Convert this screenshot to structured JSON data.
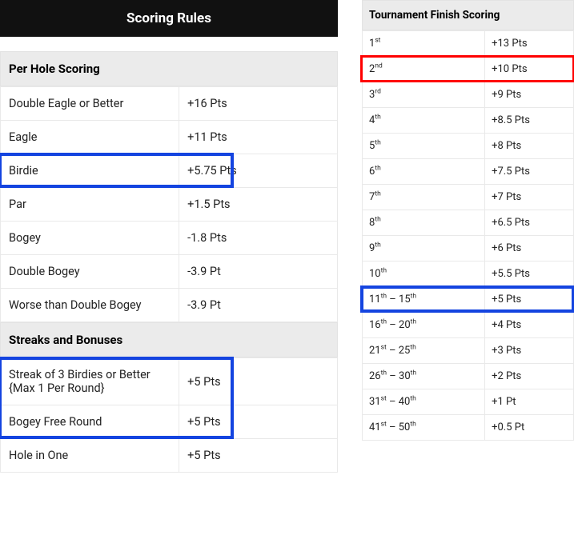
{
  "title": "Scoring Rules",
  "left": {
    "perHole": {
      "header": "Per Hole Scoring",
      "rows": [
        {
          "label": "Double Eagle or Better",
          "pts": "+16 Pts"
        },
        {
          "label": "Eagle",
          "pts": "+11 Pts"
        },
        {
          "label": "Birdie",
          "pts": "+5.75 Pts"
        },
        {
          "label": "Par",
          "pts": "+1.5 Pts"
        },
        {
          "label": "Bogey",
          "pts": "-1.8 Pts"
        },
        {
          "label": "Double Bogey",
          "pts": "-3.9 Pt"
        },
        {
          "label": "Worse than Double Bogey",
          "pts": "-3.9 Pt"
        }
      ]
    },
    "streaks": {
      "header": "Streaks and Bonuses",
      "rows": [
        {
          "label": "Streak of 3 Birdies or Better {Max 1 Per Round}",
          "pts": "+5 Pts"
        },
        {
          "label": "Bogey Free Round",
          "pts": "+5 Pts"
        },
        {
          "label": "Hole in One",
          "pts": "+5 Pts"
        }
      ]
    }
  },
  "right": {
    "header": "Tournament Finish Scoring",
    "rows": [
      {
        "rank_num": "1",
        "rank_sup": "st",
        "range": "",
        "pts": "+13 Pts"
      },
      {
        "rank_num": "2",
        "rank_sup": "nd",
        "range": "",
        "pts": "+10 Pts"
      },
      {
        "rank_num": "3",
        "rank_sup": "rd",
        "range": "",
        "pts": "+9 Pts"
      },
      {
        "rank_num": "4",
        "rank_sup": "th",
        "range": "",
        "pts": "+8.5 Pts"
      },
      {
        "rank_num": "5",
        "rank_sup": "th",
        "range": "",
        "pts": "+8 Pts"
      },
      {
        "rank_num": "6",
        "rank_sup": "th",
        "range": "",
        "pts": "+7.5 Pts"
      },
      {
        "rank_num": "7",
        "rank_sup": "th",
        "range": "",
        "pts": "+7 Pts"
      },
      {
        "rank_num": "8",
        "rank_sup": "th",
        "range": "",
        "pts": "+6.5 Pts"
      },
      {
        "rank_num": "9",
        "rank_sup": "th",
        "range": "",
        "pts": "+6 Pts"
      },
      {
        "rank_num": "10",
        "rank_sup": "th",
        "range": "",
        "pts": "+5.5 Pts"
      },
      {
        "rank_num": "11",
        "rank_sup": "th",
        "range_num": "15",
        "range_sup": "th",
        "pts": "+5 Pts"
      },
      {
        "rank_num": "16",
        "rank_sup": "th",
        "range_num": "20",
        "range_sup": "th",
        "pts": "+4 Pts"
      },
      {
        "rank_num": "21",
        "rank_sup": "st",
        "range_num": "25",
        "range_sup": "th",
        "pts": "+3 Pts"
      },
      {
        "rank_num": "26",
        "rank_sup": "th",
        "range_num": "30",
        "range_sup": "th",
        "pts": "+2 Pts"
      },
      {
        "rank_num": "31",
        "rank_sup": "st",
        "range_num": "40",
        "range_sup": "th",
        "pts": "+1 Pt"
      },
      {
        "rank_num": "41",
        "rank_sup": "st",
        "range_num": "50",
        "range_sup": "th",
        "pts": "+0.5 Pt"
      }
    ]
  },
  "highlights": {
    "left_birdie": "blue",
    "left_streaks_block": "blue",
    "right_2nd": "red",
    "right_11_15": "blue"
  }
}
